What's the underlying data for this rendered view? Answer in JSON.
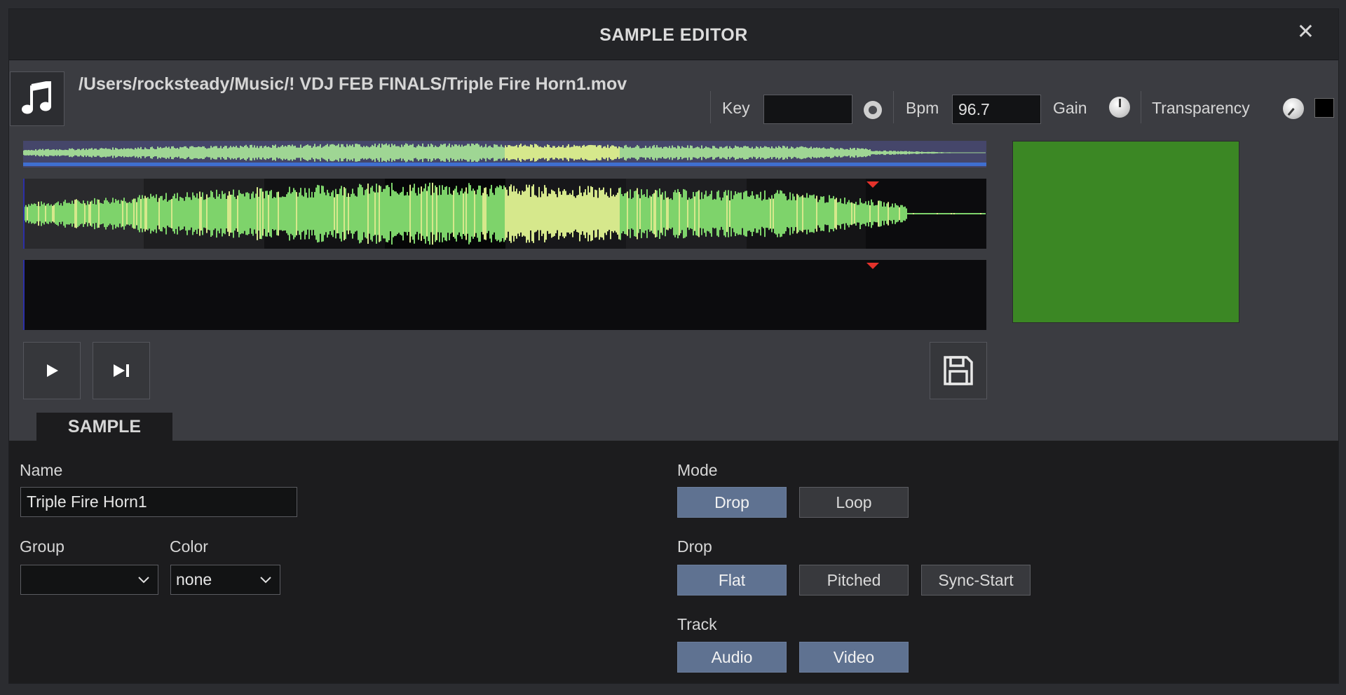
{
  "window": {
    "title": "SAMPLE EDITOR",
    "close_glyph": "✕"
  },
  "header": {
    "file_icon": "music-note-icon",
    "file_path": "/Users/rocksteady/Music/! VDJ FEB FINALS/Triple Fire Horn1.mov",
    "key_label": "Key",
    "key_value": "",
    "bpm_label": "Bpm",
    "bpm_value": "96.7",
    "gain_label": "Gain",
    "transparency_label": "Transparency"
  },
  "colors": {
    "waveform_green": "#7ed36b",
    "waveform_yellow": "#d6e88c",
    "overview_bar": "#3f6fd1",
    "marker": "#e5322b",
    "video_preview": "#3b8724",
    "active_button": "#5f7291"
  },
  "transport": {
    "play_icon": "play-icon",
    "skip_icon": "skip-to-end-icon",
    "save_icon": "floppy-disk-icon"
  },
  "tabs": {
    "sample": "SAMPLE"
  },
  "sample": {
    "name_label": "Name",
    "name_value": "Triple Fire Horn1",
    "group_label": "Group",
    "group_value": "",
    "color_label": "Color",
    "color_value": "none",
    "mode_label": "Mode",
    "mode_options": [
      {
        "label": "Drop",
        "active": true
      },
      {
        "label": "Loop",
        "active": false
      }
    ],
    "drop_label": "Drop",
    "drop_options": [
      {
        "label": "Flat",
        "active": true
      },
      {
        "label": "Pitched",
        "active": false
      },
      {
        "label": "Sync-Start",
        "active": false
      }
    ],
    "track_label": "Track",
    "track_options": [
      {
        "label": "Audio",
        "active": true
      },
      {
        "label": "Video",
        "active": true
      }
    ]
  }
}
